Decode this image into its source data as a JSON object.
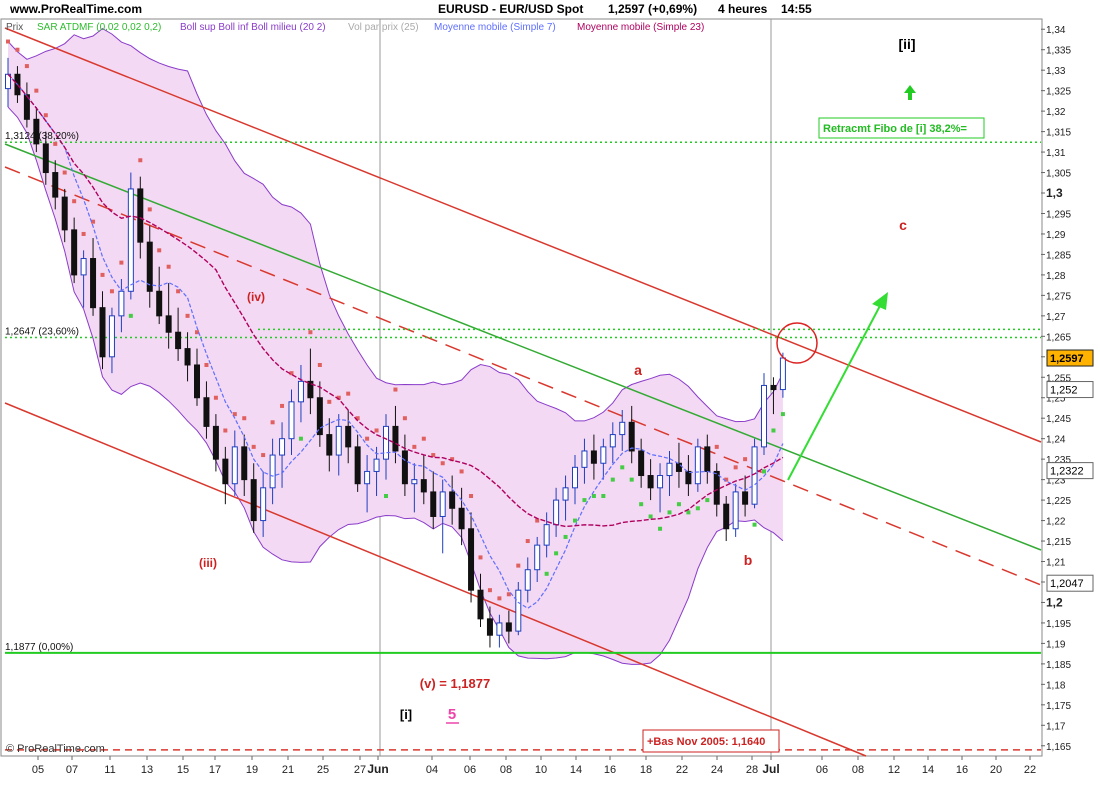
{
  "header": {
    "site": "www.ProRealTime.com",
    "title": "EURUSD - EUR/USD Spot",
    "price_change": "1,2597 (+0,69%)",
    "timeframe": "4 heures",
    "time": "14:55"
  },
  "legend": {
    "price": "Prix",
    "sar": "SAR ATDMF (0,02 0,02 0,2)",
    "boll": "Boll sup Boll inf Boll milieu (20 2)",
    "volume": "Vol par prix (25)",
    "ma7": "Moyenne mobile (Simple 7)",
    "ma23": "Moyenne mobile (Simple 23)"
  },
  "copyright": "© ProRealTime.com",
  "colors": {
    "candle_up": "#1f3fbf",
    "candle_down": "#111111",
    "boll_band": "#8a3cc9",
    "boll_fill": "#f3d9f3",
    "sar_up": "#44cc44",
    "sar_down": "#e06060",
    "ma7": "#5f6fff",
    "ma23": "#b0005f",
    "channel": "#d9382e",
    "trend_green": "#33aa33",
    "fib_line": "#22cc22",
    "label_red": "#cc2222",
    "grid": "#9a9a9a"
  },
  "chart_data": {
    "type": "candlestick",
    "symbol": "EURUSD",
    "ylim": [
      1.1625,
      1.3425
    ],
    "y_ticks": [
      "1,165",
      "1,17",
      "1,175",
      "1,18",
      "1,185",
      "1,19",
      "1,195",
      "1,2",
      "1,205",
      "1,21",
      "1,215",
      "1,22",
      "1,225",
      "1,23",
      "1,235",
      "1,24",
      "1,245",
      "1,25",
      "1,255",
      "1,26",
      "1,265",
      "1,27",
      "1,275",
      "1,28",
      "1,285",
      "1,29",
      "1,295",
      "1,3",
      "1,305",
      "1,31",
      "1,315",
      "1,32",
      "1,325",
      "1,33",
      "1,335",
      "1,34"
    ],
    "y_bold_ticks": [
      "1,2",
      "1,3"
    ],
    "x_ticks": [
      "05",
      "07",
      "11",
      "13",
      "15",
      "17",
      "19",
      "21",
      "25",
      "27",
      "Jun",
      "04",
      "06",
      "08",
      "10",
      "14",
      "16",
      "18",
      "22",
      "24",
      "28",
      "Jul",
      "06",
      "08",
      "12",
      "14",
      "16",
      "20",
      "22"
    ],
    "price_flags": [
      {
        "label": "1,2597",
        "value": 1.2597,
        "style": "last"
      },
      {
        "label": "1,252",
        "value": 1.252,
        "style": "ma"
      },
      {
        "label": "1,2322",
        "value": 1.2322,
        "style": "ma"
      },
      {
        "label": "1,2047",
        "value": 1.2047,
        "style": "ma"
      }
    ],
    "fib_levels": [
      {
        "label": "1,3124 (38,20%)",
        "value": 1.3124
      },
      {
        "label": "1,2647 (23,60%)",
        "value": 1.2647
      },
      {
        "label": "1,1877 (0,00%)",
        "value": 1.1877
      }
    ],
    "fib_extra_dotted": [
      1.2667
    ],
    "bas_level": 1.164,
    "wave_labels": [
      {
        "text": "(iii)",
        "x": "19",
        "y": 1.212
      },
      {
        "text": "(iv)",
        "x": "21",
        "y": 1.2755
      },
      {
        "text": "(v) = 1,1877",
        "x": "06",
        "y": 1.1786
      },
      {
        "text": "a",
        "x": "20",
        "y": 1.252
      },
      {
        "text": "b",
        "x": "30",
        "y": 1.2085
      },
      {
        "text": "c",
        "x": "11",
        "y": 1.2865
      },
      {
        "text": "[i]",
        "x": "04",
        "y": 1.1705
      },
      {
        "text": "5",
        "x": "06",
        "y": 1.1705
      },
      {
        "text": "[ii]",
        "x": "11",
        "y": 1.3365
      }
    ],
    "annotations": {
      "retracement": "Retracmt Fibo de [i] 38,2%=",
      "bas_nov": "+Bas Nov 2005: 1,1640"
    },
    "candles": [
      [
        1.3255,
        1.333,
        1.321,
        1.329
      ],
      [
        1.329,
        1.331,
        1.322,
        1.324
      ],
      [
        1.324,
        1.327,
        1.316,
        1.318
      ],
      [
        1.318,
        1.321,
        1.31,
        1.312
      ],
      [
        1.312,
        1.315,
        1.302,
        1.305
      ],
      [
        1.305,
        1.308,
        1.296,
        1.299
      ],
      [
        1.299,
        1.301,
        1.288,
        1.291
      ],
      [
        1.291,
        1.294,
        1.278,
        1.28
      ],
      [
        1.28,
        1.286,
        1.272,
        1.284
      ],
      [
        1.284,
        1.289,
        1.27,
        1.272
      ],
      [
        1.272,
        1.276,
        1.257,
        1.26
      ],
      [
        1.26,
        1.272,
        1.256,
        1.27
      ],
      [
        1.27,
        1.279,
        1.266,
        1.276
      ],
      [
        1.276,
        1.305,
        1.274,
        1.301
      ],
      [
        1.301,
        1.304,
        1.284,
        1.288
      ],
      [
        1.288,
        1.292,
        1.272,
        1.276
      ],
      [
        1.276,
        1.282,
        1.268,
        1.27
      ],
      [
        1.27,
        1.278,
        1.262,
        1.266
      ],
      [
        1.266,
        1.272,
        1.259,
        1.262
      ],
      [
        1.262,
        1.266,
        1.254,
        1.258
      ],
      [
        1.258,
        1.262,
        1.248,
        1.25
      ],
      [
        1.25,
        1.254,
        1.24,
        1.243
      ],
      [
        1.243,
        1.246,
        1.232,
        1.235
      ],
      [
        1.235,
        1.238,
        1.224,
        1.229
      ],
      [
        1.229,
        1.242,
        1.226,
        1.238
      ],
      [
        1.238,
        1.241,
        1.226,
        1.23
      ],
      [
        1.23,
        1.234,
        1.217,
        1.22
      ],
      [
        1.22,
        1.232,
        1.216,
        1.228
      ],
      [
        1.228,
        1.24,
        1.224,
        1.236
      ],
      [
        1.236,
        1.244,
        1.228,
        1.24
      ],
      [
        1.24,
        1.252,
        1.236,
        1.249
      ],
      [
        1.249,
        1.258,
        1.244,
        1.254
      ],
      [
        1.254,
        1.262,
        1.246,
        1.25
      ],
      [
        1.25,
        1.254,
        1.238,
        1.241
      ],
      [
        1.241,
        1.245,
        1.232,
        1.236
      ],
      [
        1.236,
        1.246,
        1.231,
        1.243
      ],
      [
        1.243,
        1.247,
        1.234,
        1.238
      ],
      [
        1.238,
        1.241,
        1.227,
        1.229
      ],
      [
        1.229,
        1.236,
        1.222,
        1.232
      ],
      [
        1.232,
        1.238,
        1.226,
        1.235
      ],
      [
        1.235,
        1.246,
        1.23,
        1.243
      ],
      [
        1.243,
        1.248,
        1.234,
        1.237
      ],
      [
        1.237,
        1.241,
        1.226,
        1.229
      ],
      [
        1.229,
        1.234,
        1.222,
        1.23
      ],
      [
        1.23,
        1.236,
        1.224,
        1.227
      ],
      [
        1.227,
        1.232,
        1.218,
        1.221
      ],
      [
        1.221,
        1.23,
        1.212,
        1.227
      ],
      [
        1.227,
        1.231,
        1.219,
        1.223
      ],
      [
        1.223,
        1.228,
        1.214,
        1.218
      ],
      [
        1.218,
        1.222,
        1.2,
        1.203
      ],
      [
        1.203,
        1.207,
        1.194,
        1.196
      ],
      [
        1.196,
        1.199,
        1.189,
        1.192
      ],
      [
        1.192,
        1.197,
        1.189,
        1.195
      ],
      [
        1.195,
        1.198,
        1.19,
        1.193
      ],
      [
        1.193,
        1.205,
        1.192,
        1.203
      ],
      [
        1.203,
        1.211,
        1.2,
        1.208
      ],
      [
        1.208,
        1.216,
        1.205,
        1.214
      ],
      [
        1.214,
        1.222,
        1.211,
        1.219
      ],
      [
        1.219,
        1.228,
        1.216,
        1.225
      ],
      [
        1.225,
        1.231,
        1.22,
        1.228
      ],
      [
        1.228,
        1.236,
        1.224,
        1.233
      ],
      [
        1.233,
        1.24,
        1.229,
        1.237
      ],
      [
        1.237,
        1.241,
        1.23,
        1.234
      ],
      [
        1.234,
        1.24,
        1.23,
        1.238
      ],
      [
        1.238,
        1.244,
        1.234,
        1.241
      ],
      [
        1.241,
        1.247,
        1.237,
        1.244
      ],
      [
        1.244,
        1.248,
        1.234,
        1.237
      ],
      [
        1.237,
        1.24,
        1.228,
        1.231
      ],
      [
        1.231,
        1.235,
        1.225,
        1.228
      ],
      [
        1.228,
        1.234,
        1.222,
        1.231
      ],
      [
        1.231,
        1.237,
        1.226,
        1.234
      ],
      [
        1.234,
        1.239,
        1.228,
        1.232
      ],
      [
        1.232,
        1.236,
        1.226,
        1.229
      ],
      [
        1.229,
        1.24,
        1.227,
        1.238
      ],
      [
        1.238,
        1.241,
        1.229,
        1.232
      ],
      [
        1.232,
        1.234,
        1.221,
        1.224
      ],
      [
        1.224,
        1.226,
        1.215,
        1.218
      ],
      [
        1.218,
        1.229,
        1.216,
        1.227
      ],
      [
        1.227,
        1.231,
        1.221,
        1.224
      ],
      [
        1.224,
        1.24,
        1.223,
        1.238
      ],
      [
        1.238,
        1.256,
        1.236,
        1.253
      ],
      [
        1.253,
        1.255,
        1.246,
        1.252
      ],
      [
        1.252,
        1.261,
        1.25,
        1.2597
      ]
    ]
  }
}
